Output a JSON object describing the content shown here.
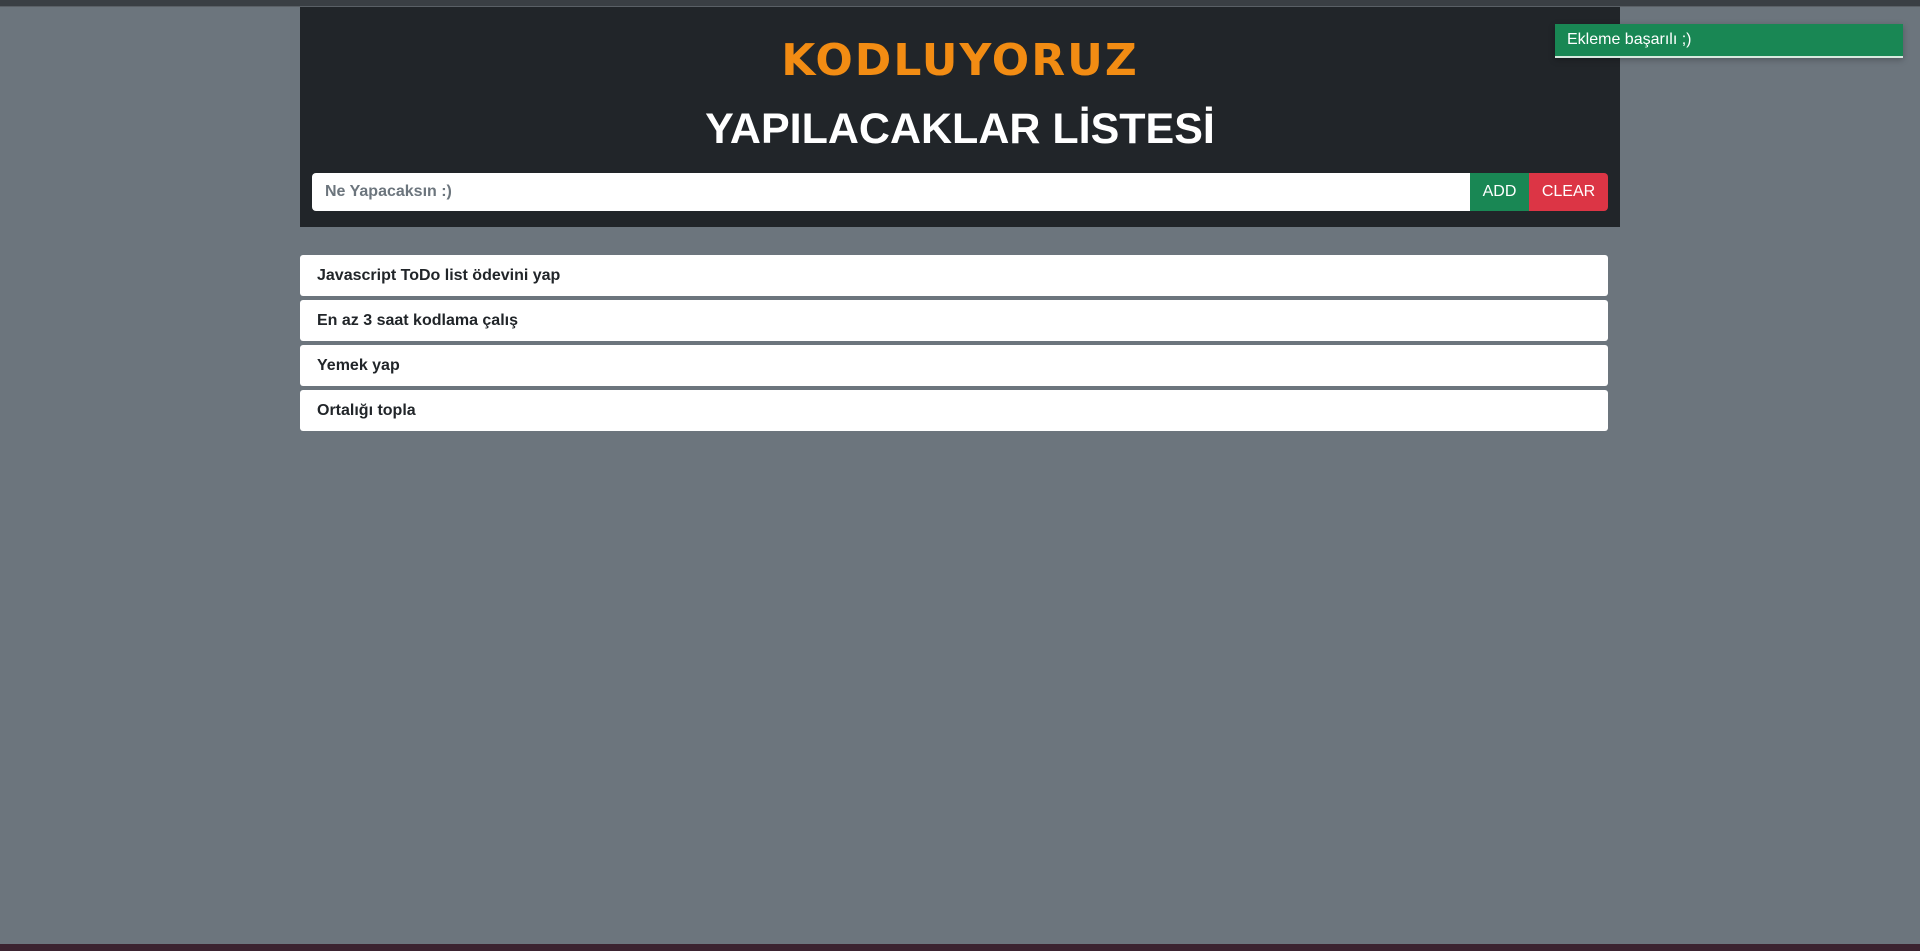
{
  "header": {
    "logo_text": "KODLUYORUZ",
    "title": "YAPILACAKLAR LİSTESİ"
  },
  "form": {
    "input_placeholder": "Ne Yapacaksın :)",
    "input_value": "",
    "add_label": "ADD",
    "clear_label": "CLEAR"
  },
  "tasks": [
    {
      "text": "Javascript ToDo list ödevini yap"
    },
    {
      "text": "En az 3 saat kodlama çalış"
    },
    {
      "text": "Yemek yap"
    },
    {
      "text": "Ortalığı topla"
    }
  ],
  "toast": {
    "message": "Ekleme başarılı ;)"
  },
  "colors": {
    "background": "#6c757d",
    "header": "#212529",
    "brand": "#f28c13",
    "success": "#198754",
    "danger": "#dc3545"
  }
}
